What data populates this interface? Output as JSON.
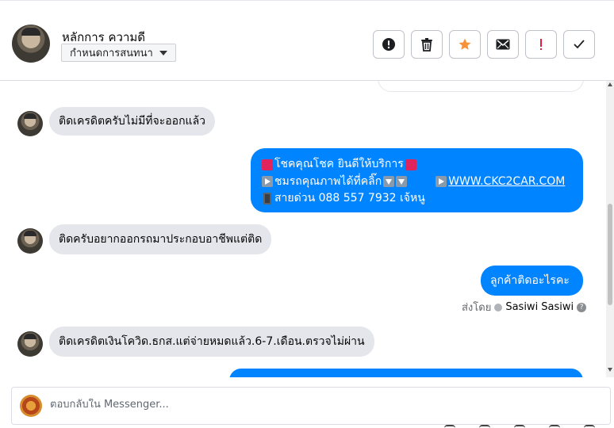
{
  "header": {
    "contact_name": "หลักการ ความดี",
    "chat_settings_label": "กำหนดการสนทนา",
    "actions": [
      {
        "name": "spam-button",
        "icon": "exclamation-circle-icon"
      },
      {
        "name": "delete-button",
        "icon": "trash-icon"
      },
      {
        "name": "star-button",
        "icon": "star-icon",
        "color": "#f7923a"
      },
      {
        "name": "mark-unread-button",
        "icon": "envelope-icon"
      },
      {
        "name": "follow-up-button",
        "icon": "exclamation-icon",
        "color": "#e41e3f"
      },
      {
        "name": "mark-done-button",
        "icon": "checkmark-icon"
      }
    ]
  },
  "messages": [
    {
      "direction": "in",
      "text": "ติดเครดิตครับไม่มีที่จะออกแล้ว"
    },
    {
      "direction": "out",
      "line1": "โชคคุณโชค ยินดีให้บริการ",
      "line2": "ชมรถคุณภาพได้ที่คลิ๊ก",
      "link": "WWW.CKC2CAR.COM",
      "line3": "สายด่วน 088 557 7932 เจ้หนู"
    },
    {
      "direction": "in",
      "text": "ติดครับอยากออกรถมาประกอบอาชีพแต่ติด"
    },
    {
      "direction": "out",
      "text": "ลูกค้าติดอะไรคะ"
    },
    {
      "direction": "in",
      "text": "ติดเครดิตเงินโควิด.ธกส.แต่จ่ายหมดแล้ว.6-7.เดือน.ตรวจไม่ผ่าน"
    }
  ],
  "sent_by": {
    "prefix": "ส่งโดย",
    "name": "Sasiwi Sasiwi",
    "help": "?"
  },
  "composer": {
    "placeholder": "ตอบกลับใน Messenger..."
  },
  "colors": {
    "outgoing": "#0084ff",
    "incoming": "#e4e6eb",
    "star": "#f7923a",
    "alert": "#e41e3f"
  }
}
